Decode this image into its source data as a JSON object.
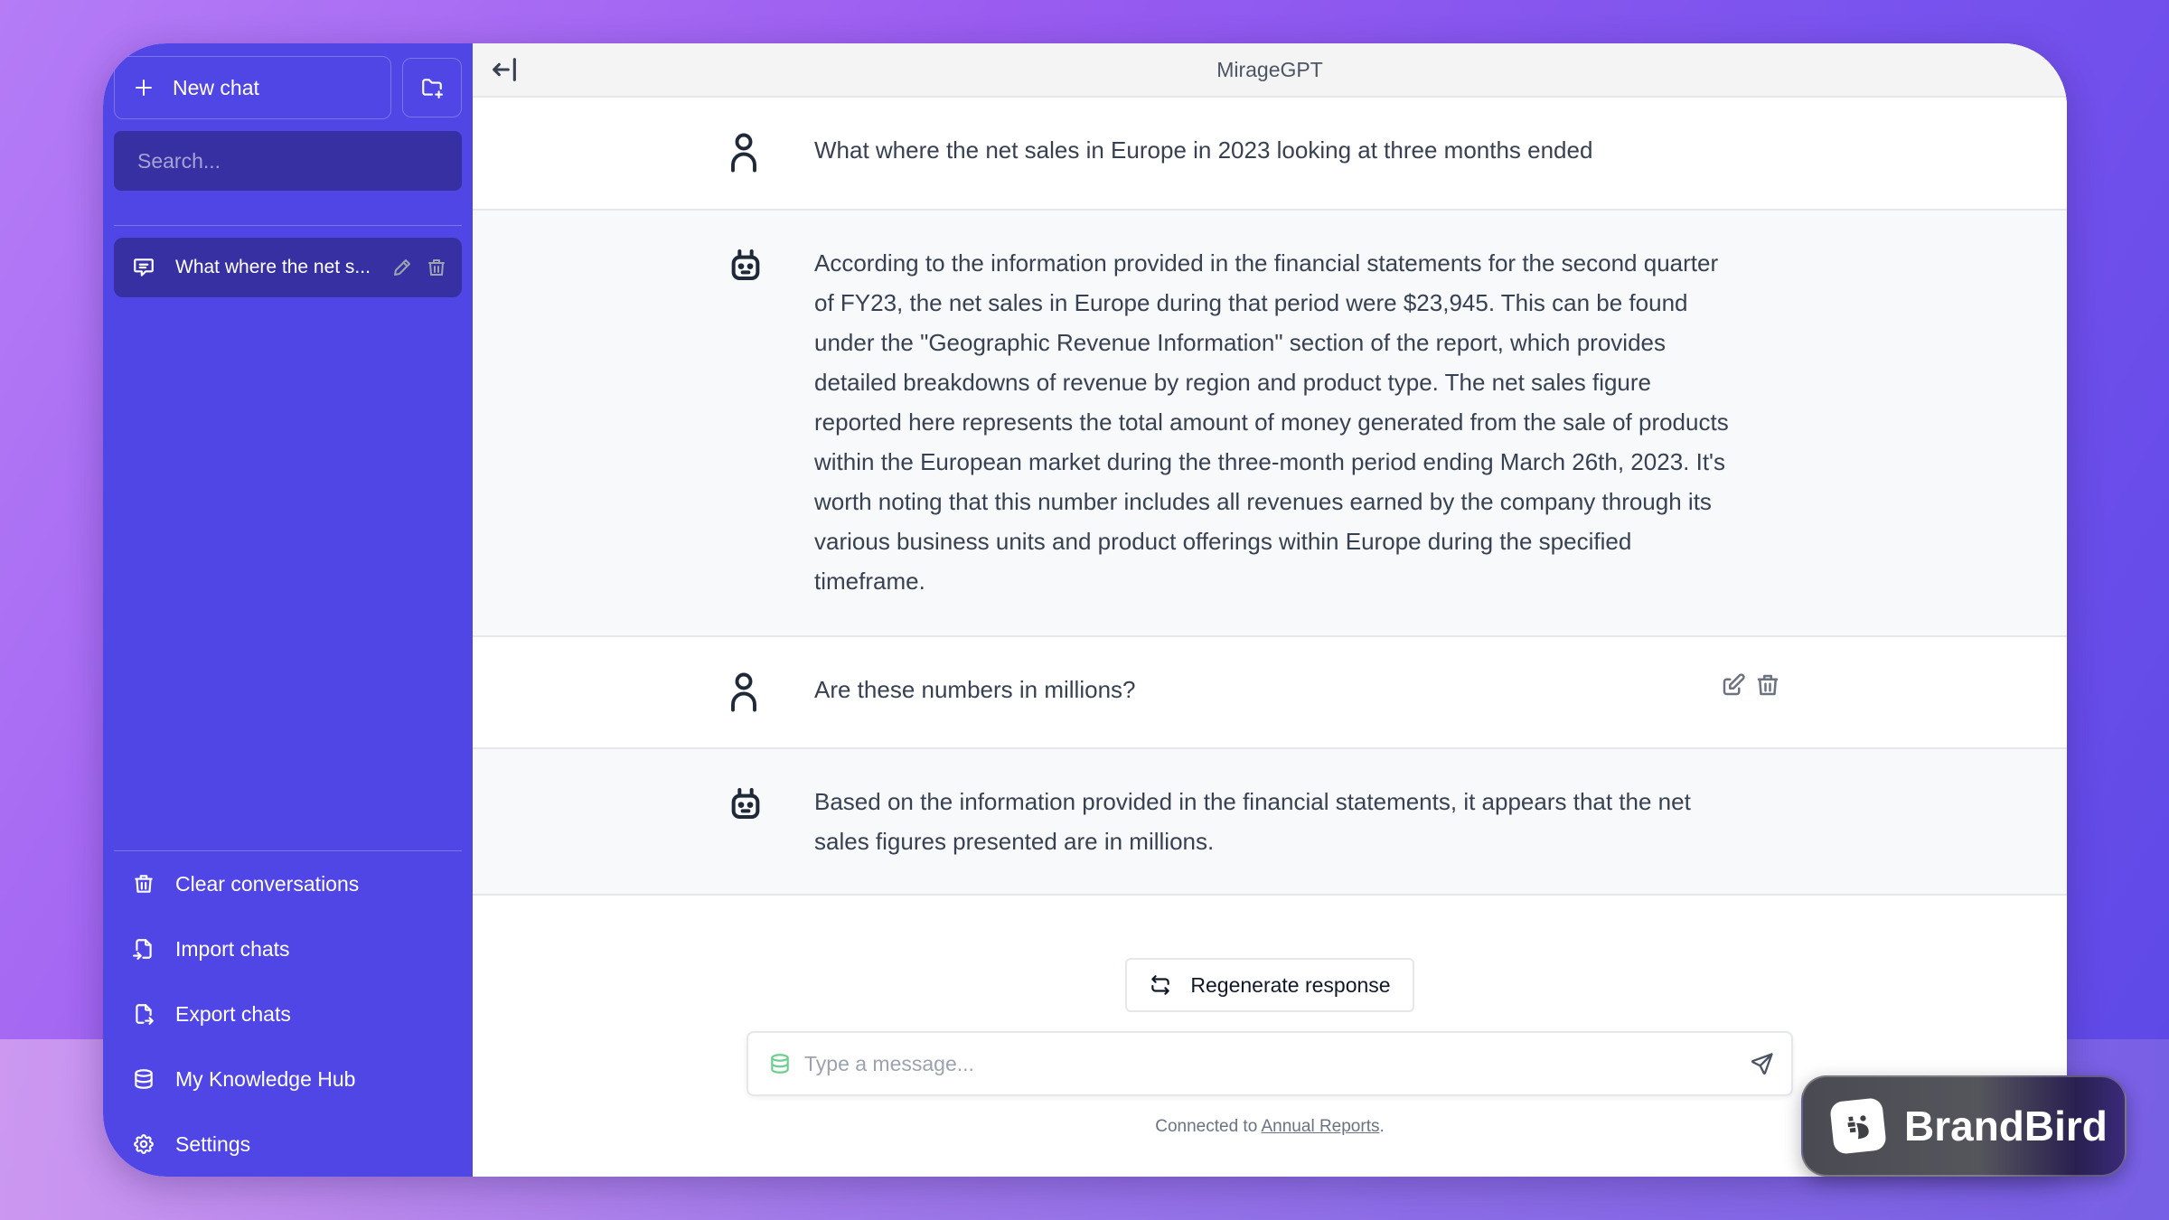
{
  "app": {
    "title": "MirageGPT"
  },
  "sidebar": {
    "new_chat_label": "New chat",
    "search_placeholder": "Search...",
    "conversations": [
      {
        "title": "What where the net s...",
        "icon": "message-icon"
      }
    ],
    "menu": [
      {
        "label": "Clear conversations",
        "icon": "trash-icon"
      },
      {
        "label": "Import chats",
        "icon": "file-import-icon"
      },
      {
        "label": "Export chats",
        "icon": "file-export-icon"
      },
      {
        "label": "My Knowledge Hub",
        "icon": "database-icon"
      },
      {
        "label": "Settings",
        "icon": "gear-icon"
      }
    ]
  },
  "messages": [
    {
      "role": "user",
      "text": "What where the net sales in Europe in 2023 looking at three months ended"
    },
    {
      "role": "assistant",
      "text": "According to the information provided in the financial statements for the second quarter of FY23, the net sales in Europe during that period were $23,945. This can be found under the \"Geographic Revenue Information\" section of the report, which provides detailed breakdowns of revenue by region and product type. The net sales figure reported here represents the total amount of money generated from the sale of products within the European market during the three-month period ending March 26th, 2023. It's worth noting that this number includes all revenues earned by the company through its various business units and product offerings within Europe during the specified timeframe."
    },
    {
      "role": "user",
      "text": "Are these numbers in millions?"
    },
    {
      "role": "assistant",
      "text": "Based on the information provided in the financial statements, it appears that the net sales figures presented are in millions."
    }
  ],
  "regenerate_label": "Regenerate response",
  "composer": {
    "placeholder": "Type a message...",
    "value": ""
  },
  "footer": {
    "prefix": "Connected to ",
    "link": "Annual Reports",
    "suffix": "."
  },
  "watermark": {
    "name": "BrandBird"
  },
  "colors": {
    "sidebar": "#4f46e5",
    "sidebar_active": "#3730a3",
    "knowledge_icon": "#6ccf8e"
  }
}
